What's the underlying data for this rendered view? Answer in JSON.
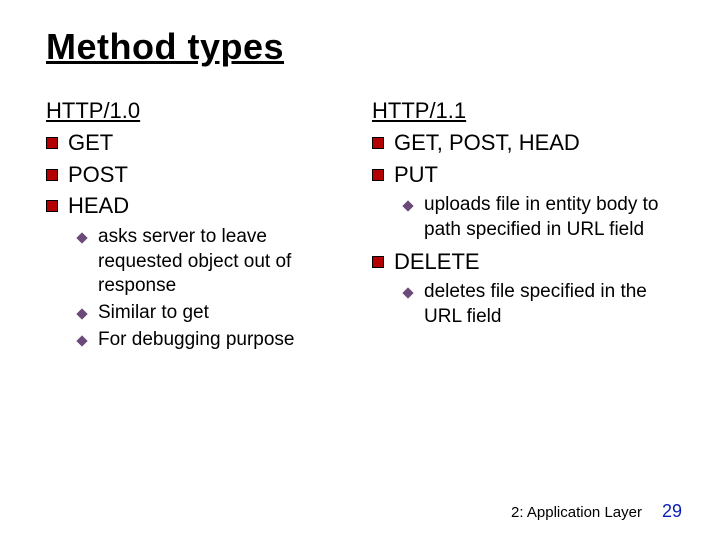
{
  "title": "Method types",
  "left": {
    "version": "HTTP/1.0",
    "items": [
      "GET",
      "POST",
      "HEAD"
    ],
    "sub": [
      "asks server to leave requested object out of response",
      "Similar to get",
      "For debugging purpose"
    ]
  },
  "right": {
    "version": "HTTP/1.1",
    "item1": "GET, POST, HEAD",
    "item2": "PUT",
    "sub2": "uploads file in entity body to path specified in URL field",
    "item3": "DELETE",
    "sub3": "deletes file specified in the URL field"
  },
  "footer": {
    "section": "2: Application Layer",
    "page": "29"
  }
}
